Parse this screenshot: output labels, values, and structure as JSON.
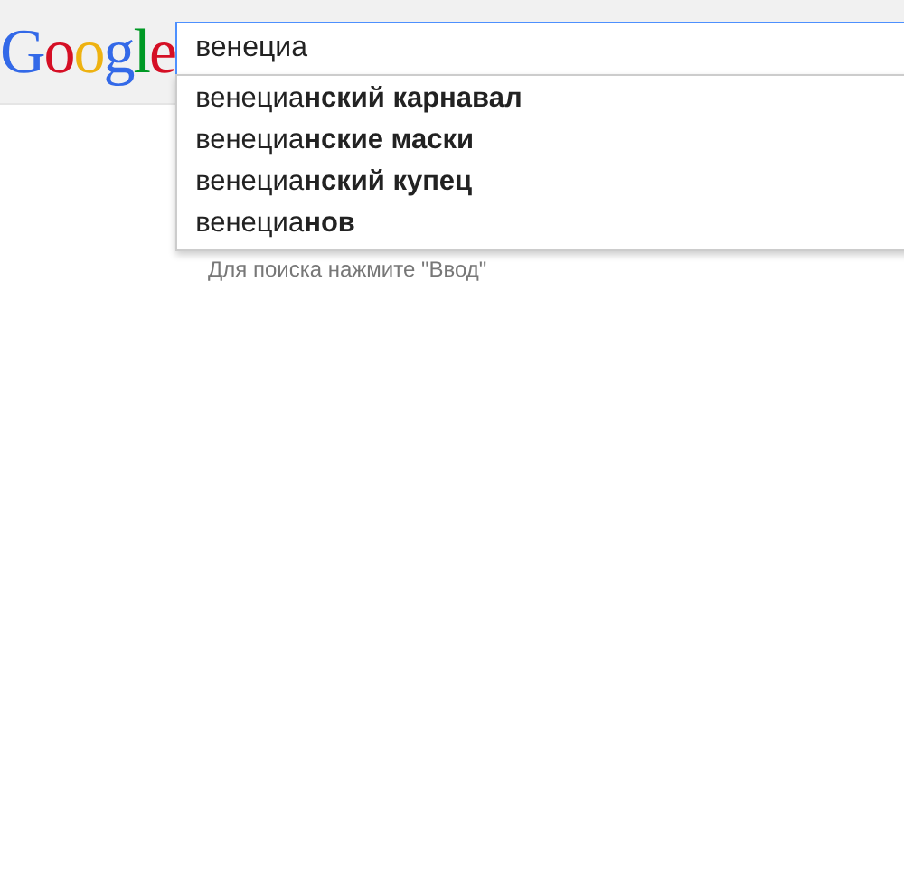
{
  "logo": "Google",
  "search": {
    "value": "венециа"
  },
  "suggestions": [
    "венециа**нский карнавал**",
    "венециа**нские маски**",
    "венециа**нский купец**",
    "венециа**нов**"
  ],
  "hint": "Для поиска нажмите \"Ввод\""
}
